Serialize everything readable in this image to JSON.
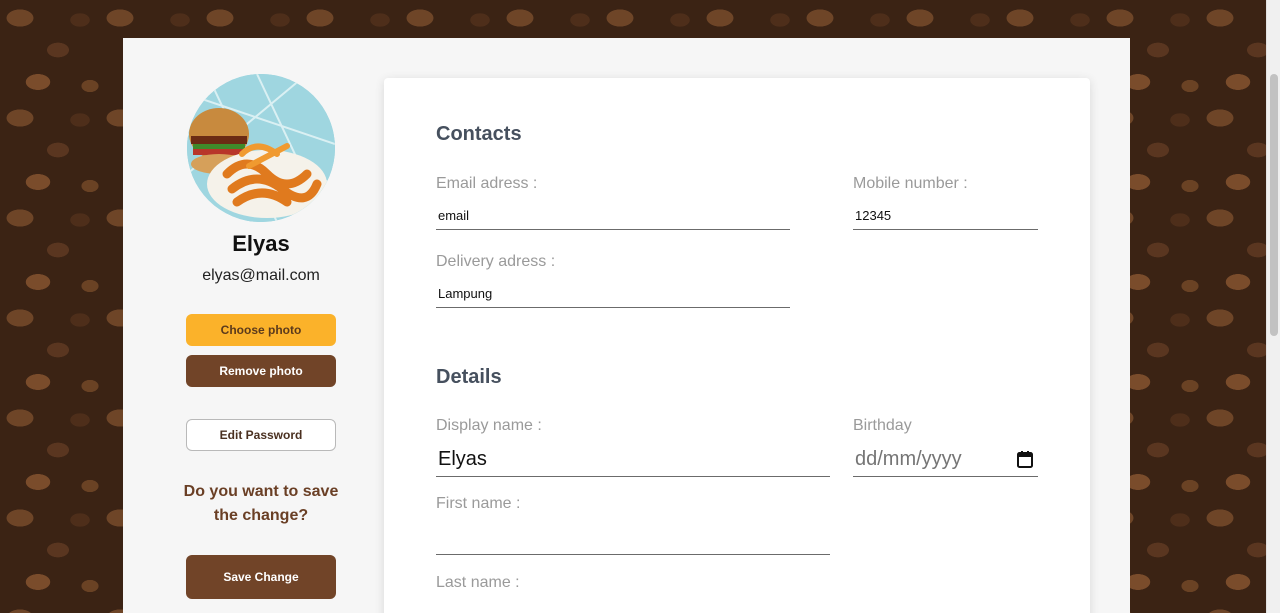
{
  "profile": {
    "name": "Elyas",
    "email": "elyas@mail.com"
  },
  "sidebar": {
    "choose_photo": "Choose photo",
    "remove_photo": "Remove photo",
    "edit_password": "Edit Password",
    "question": "Do you want to save the change?",
    "save_change": "Save Change"
  },
  "contacts": {
    "title": "Contacts",
    "email_label": "Email adress :",
    "email_value": "email",
    "mobile_label": "Mobile number :",
    "mobile_value": "12345",
    "delivery_label": "Delivery adress :",
    "delivery_value": "Lampung"
  },
  "details": {
    "title": "Details",
    "display_name_label": "Display name :",
    "display_name_value": "Elyas",
    "birthday_label": "Birthday",
    "birthday_placeholder": "dd/mm/yyyy",
    "first_name_label": "First name :",
    "first_name_value": "",
    "last_name_label": "Last name :"
  },
  "colors": {
    "accent_yellow": "#fbb22a",
    "brand_brown": "#714428",
    "heading_slate": "#46505e"
  },
  "icons": {
    "calendar": "calendar-icon"
  }
}
